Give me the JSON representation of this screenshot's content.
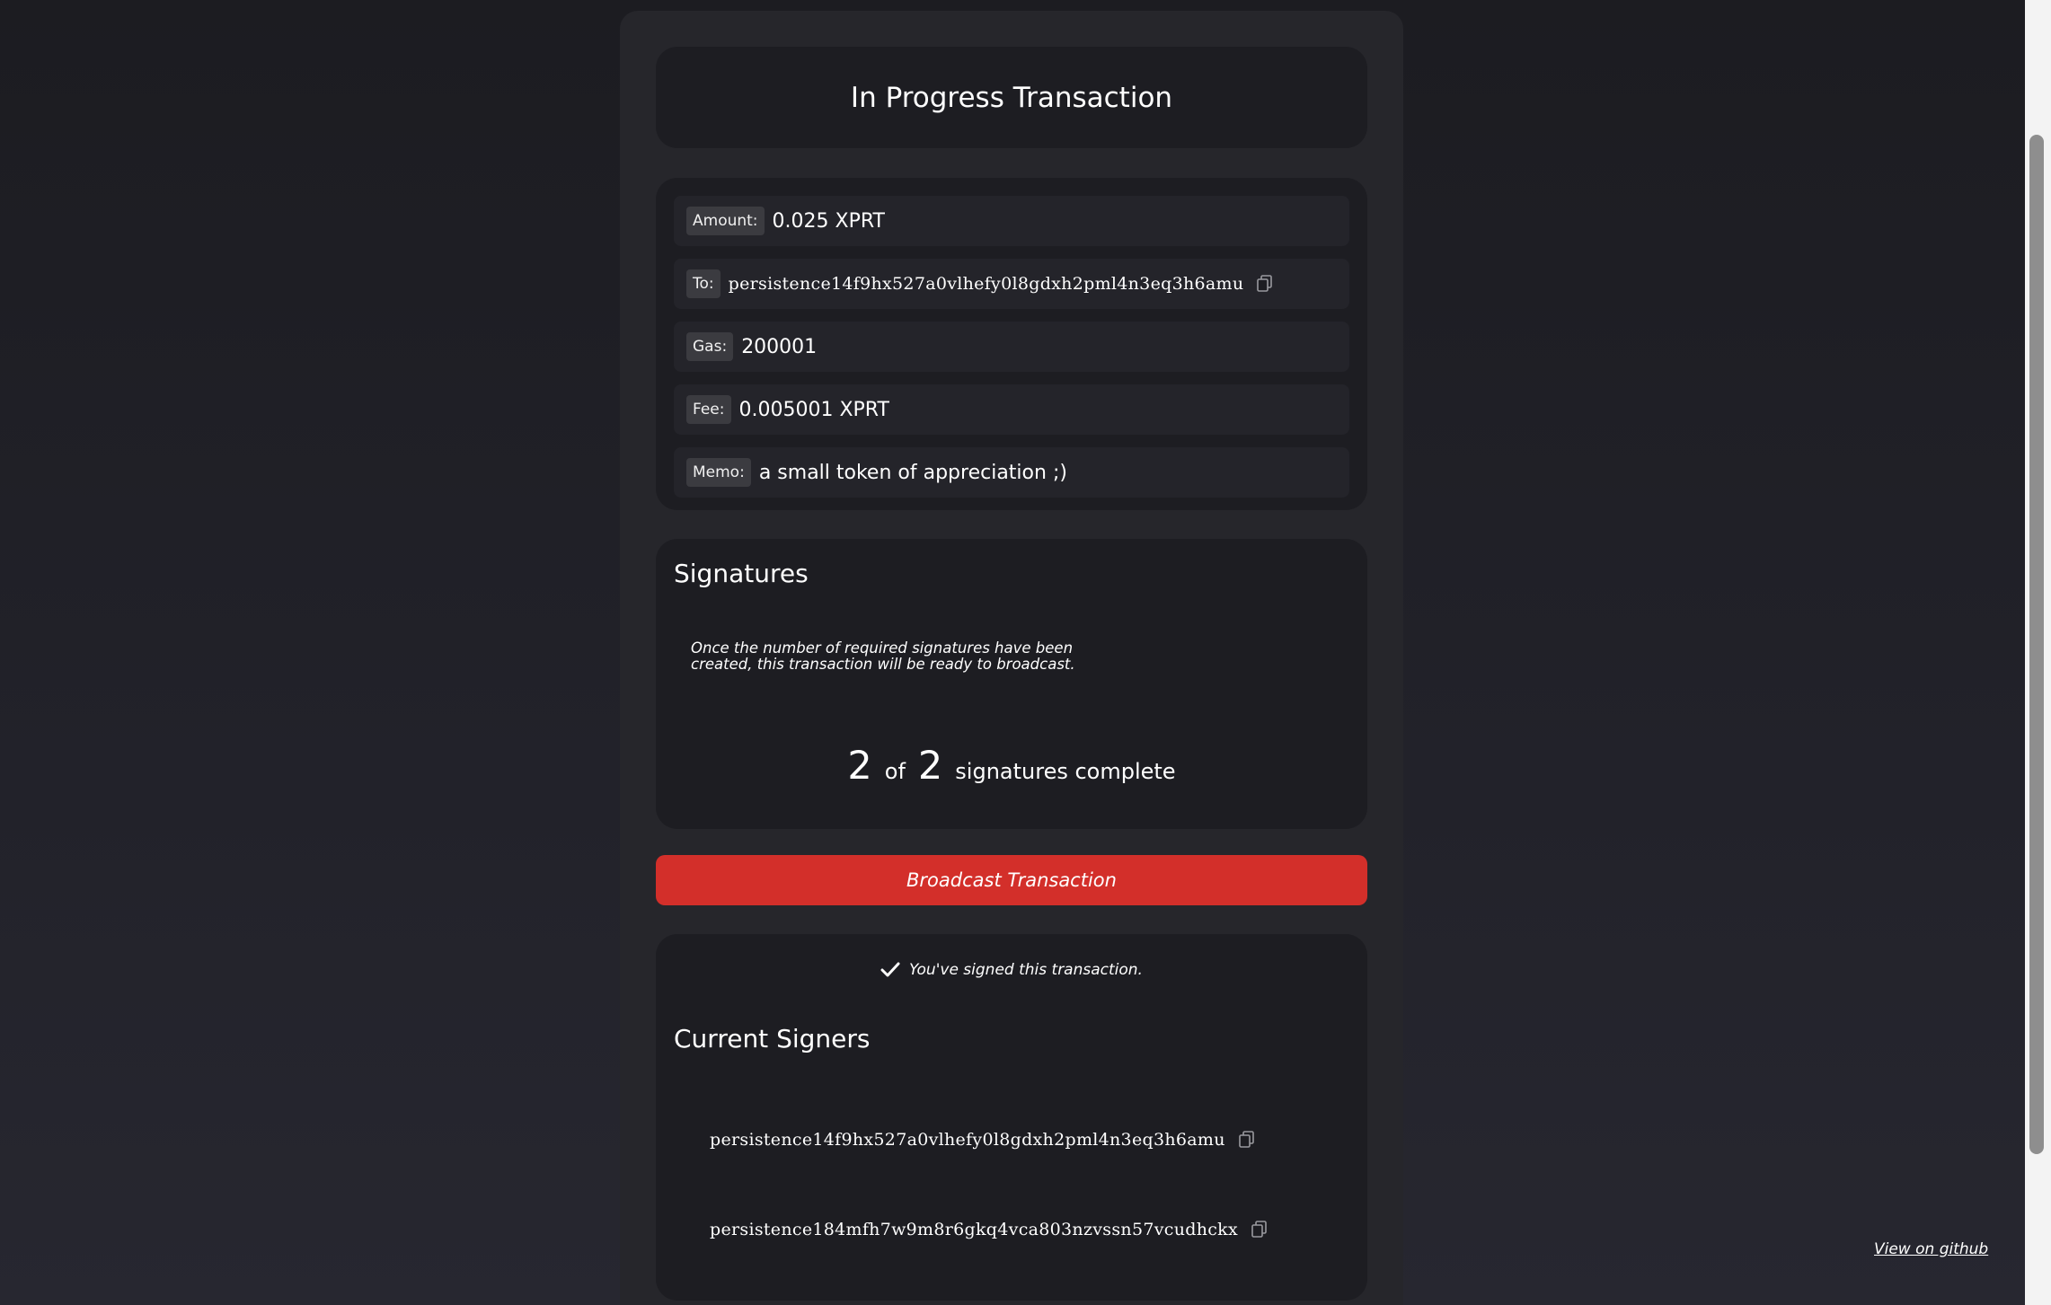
{
  "header": {
    "title": "In Progress Transaction"
  },
  "details": {
    "amount_label": "Amount:",
    "amount_value": "0.025 XPRT",
    "to_label": "To:",
    "to_value": "persistence14f9hx527a0vlhefy0l8gdxh2pml4n3eq3h6amu",
    "gas_label": "Gas:",
    "gas_value": "200001",
    "fee_label": "Fee:",
    "fee_value": "0.005001 XPRT",
    "memo_label": "Memo:",
    "memo_value": "a small token of appreciation ;)"
  },
  "signatures": {
    "heading": "Signatures",
    "note": "Once the number of required signatures have been created, this transaction will be ready to broadcast.",
    "current": "2",
    "of_label": "of",
    "required": "2",
    "complete_label": "signatures complete"
  },
  "broadcast": {
    "label": "Broadcast Transaction"
  },
  "signers": {
    "signed_note": "You've signed this transaction.",
    "heading": "Current Signers",
    "list": [
      "persistence14f9hx527a0vlhefy0l8gdxh2pml4n3eq3h6amu",
      "persistence184mfh7w9m8r6gkq4vca803nzvssn57vcudhckx"
    ]
  },
  "footer": {
    "github_link": "View on github"
  },
  "colors": {
    "accent": "#d32f2a",
    "card": "#1d1d22",
    "row": "#24242a"
  },
  "icons": {
    "copy": "copy-icon",
    "check": "checkmark-icon"
  }
}
